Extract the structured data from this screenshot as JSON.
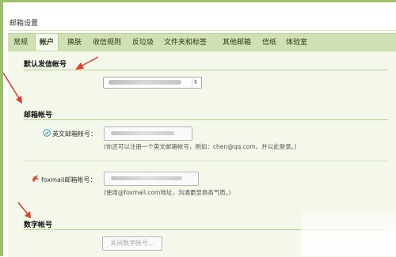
{
  "window": {
    "title": "邮箱设置"
  },
  "tabs": [
    {
      "label": "常规"
    },
    {
      "label": "帐户",
      "active": true
    },
    {
      "label": "换肤"
    },
    {
      "label": "收信规则"
    },
    {
      "label": "反垃圾"
    },
    {
      "label": "文件夹和标签"
    },
    {
      "label": "其他邮箱"
    },
    {
      "label": "信纸"
    },
    {
      "label": "体验室"
    }
  ],
  "sections": {
    "default_sender": {
      "title": "默认发信帐号",
      "selected_value": ""
    },
    "email_accounts": {
      "title": "邮箱帐号",
      "english": {
        "label": "英文邮箱帐号：",
        "hint": "(你还可以注册一个英文邮箱帐号，例如：chen@qq.com，并以此登录。)"
      },
      "foxmail": {
        "label": "foxmail邮箱帐号：",
        "hint": "(使用@foxmail.com地址，沟通更显商务气质。)"
      }
    },
    "digital_account": {
      "title": "数字帐号",
      "button_label": "关闭数字帐号..."
    }
  },
  "colors": {
    "frame": "#9cc06a",
    "tabbar": "#cfe0b2",
    "panel": "#f3f8ea",
    "annotation_arrow": "#e23a2b"
  }
}
